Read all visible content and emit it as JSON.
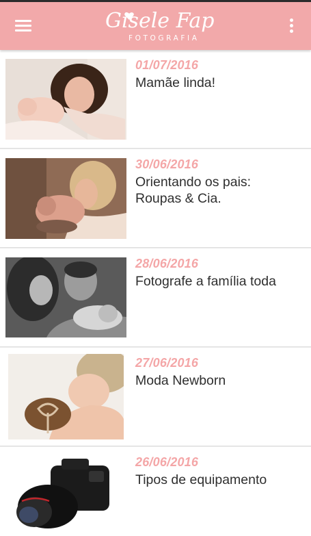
{
  "app": {
    "logo_script": "Gisele Fap",
    "logo_sub": "FOTOGRAFIA",
    "accent_color": "#f2a9aa",
    "date_color": "#f4a6a7",
    "menu_icon": "hamburger-menu-icon",
    "overflow_icon": "more-vertical-icon"
  },
  "posts": [
    {
      "date": "01/07/2016",
      "title": "Mamãe linda!",
      "image": "mother-with-newborn-photo"
    },
    {
      "date": "30/06/2016",
      "title": "Orientando os pais: Roupas & Cia.",
      "image": "mother-kissing-newborn-photo"
    },
    {
      "date": "28/06/2016",
      "title": "Fotografe a família toda",
      "image": "family-with-newborn-bw-photo"
    },
    {
      "date": "27/06/2016",
      "title": "Moda Newborn",
      "image": "newborn-knit-hat-photo"
    },
    {
      "date": "26/06/2016",
      "title": "Tipos de equipamento",
      "image": "dslr-camera-photo"
    }
  ]
}
